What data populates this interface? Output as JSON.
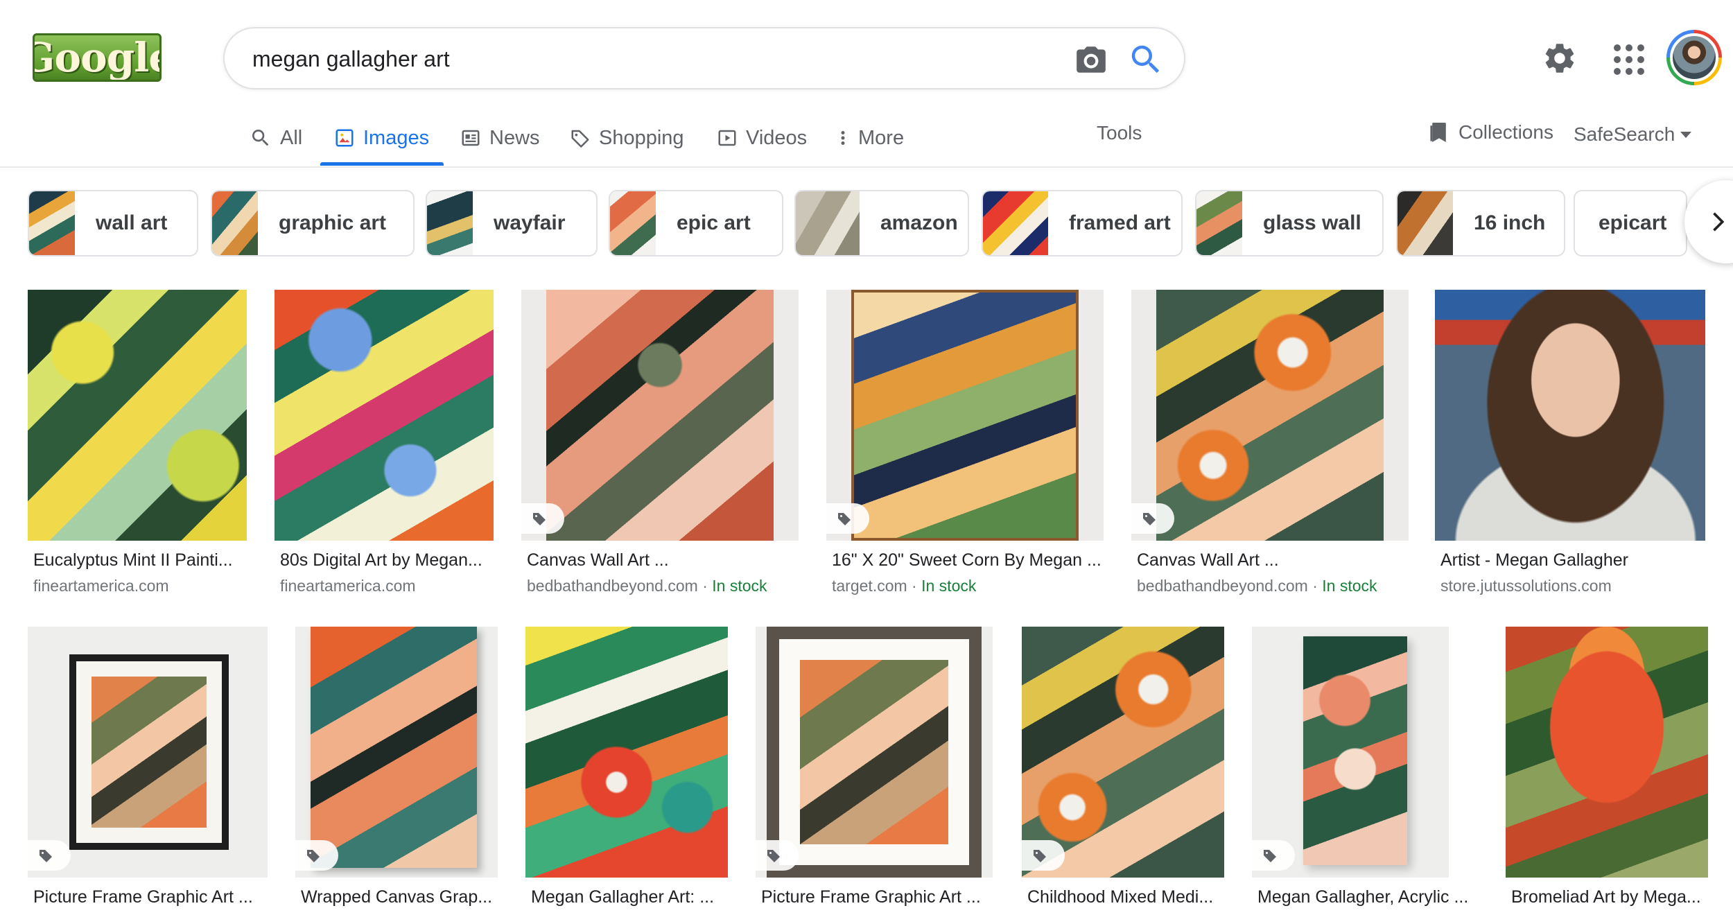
{
  "logo": {
    "text": "Google"
  },
  "search": {
    "query": "megan gallagher art",
    "camera_icon": "camera-icon",
    "search_icon": "search-icon"
  },
  "header": {
    "settings_icon": "gear-icon",
    "apps_icon": "apps-grid-icon",
    "avatar": "account-avatar"
  },
  "tabs": [
    {
      "label": "All",
      "icon": "search-icon",
      "active": false
    },
    {
      "label": "Images",
      "icon": "image-icon",
      "active": true
    },
    {
      "label": "News",
      "icon": "news-icon",
      "active": false
    },
    {
      "label": "Shopping",
      "icon": "tag-icon",
      "active": false
    },
    {
      "label": "Videos",
      "icon": "play-icon",
      "active": false
    },
    {
      "label": "More",
      "icon": "more-vert-icon",
      "active": false
    }
  ],
  "tools_label": "Tools",
  "collections_label": "Collections",
  "safesearch_label": "SafeSearch",
  "chips": [
    {
      "label": "wall art"
    },
    {
      "label": "graphic art"
    },
    {
      "label": "wayfair"
    },
    {
      "label": "epic art"
    },
    {
      "label": "amazon"
    },
    {
      "label": "framed art"
    },
    {
      "label": "glass wall"
    },
    {
      "label": "16 inch"
    },
    {
      "label": "epicart"
    }
  ],
  "results_row1": [
    {
      "caption": "Eucalyptus Mint II Painti...",
      "source": "fineartamerica.com",
      "stock": "",
      "tag": false
    },
    {
      "caption": "80s Digital Art by Megan...",
      "source": "fineartamerica.com",
      "stock": "",
      "tag": false
    },
    {
      "caption": "Canvas Wall Art ...",
      "source": "bedbathandbeyond.com",
      "stock": "In stock",
      "tag": true
    },
    {
      "caption": "16\" X 20\" Sweet Corn By Megan ...",
      "source": "target.com",
      "stock": "In stock",
      "tag": true
    },
    {
      "caption": "Canvas Wall Art ...",
      "source": "bedbathandbeyond.com",
      "stock": "In stock",
      "tag": true
    },
    {
      "caption": "Artist - Megan Gallagher",
      "source": "store.jutussolutions.com",
      "stock": "",
      "tag": false
    }
  ],
  "results_row2": [
    {
      "caption": "Picture Frame Graphic Art ...",
      "tag": true
    },
    {
      "caption": "Wrapped Canvas Grap...",
      "tag": true
    },
    {
      "caption": "Megan Gallagher Art: ...",
      "tag": false
    },
    {
      "caption": "Picture Frame Graphic Art ...",
      "tag": true
    },
    {
      "caption": "Childhood Mixed Medi...",
      "tag": true
    },
    {
      "caption": "Megan Gallagher, Acrylic ...",
      "tag": true
    },
    {
      "caption": "Bromeliad Art by Mega...",
      "tag": false
    }
  ],
  "stock_separator": " · "
}
